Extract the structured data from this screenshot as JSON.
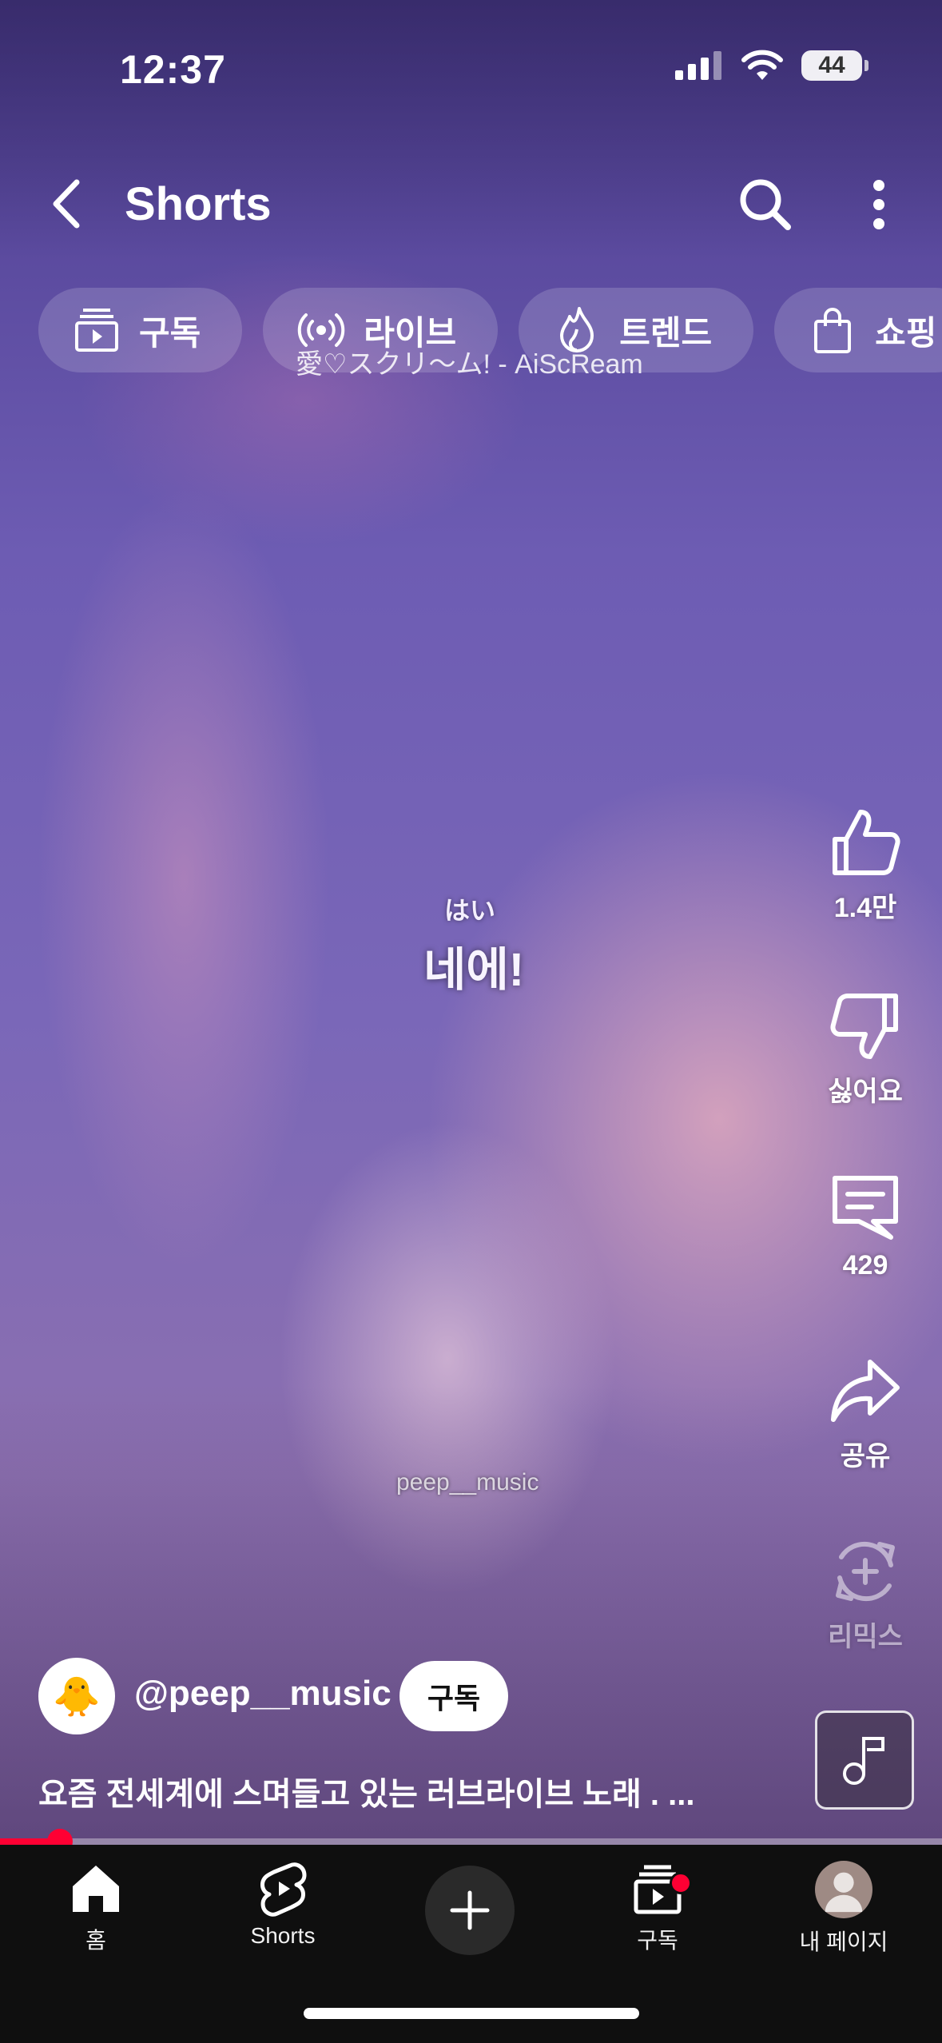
{
  "status": {
    "time": "12:37",
    "battery": "44"
  },
  "header": {
    "title": "Shorts"
  },
  "chips": [
    {
      "label": "구독",
      "icon": "subscriptions-icon"
    },
    {
      "label": "라이브",
      "icon": "live-icon"
    },
    {
      "label": "트렌드",
      "icon": "trending-flame-icon"
    },
    {
      "label": "쇼핑",
      "icon": "shopping-bag-icon"
    }
  ],
  "video": {
    "song_credit": "愛♡スクリ〜ム! - AiScReam",
    "caption_small": "はい",
    "caption_big": "네에!",
    "watermark": "peep__music"
  },
  "actions": {
    "like_count": "1.4만",
    "dislike_label": "싫어요",
    "comment_count": "429",
    "share_label": "공유",
    "remix_label": "리믹스"
  },
  "channel": {
    "avatar_emoji": "🐥",
    "handle": "@peep__music",
    "subscribe_label": "구독",
    "description": "요즘 전세계에 스며들고 있는 러브라이브 노래 . ..."
  },
  "progress": {
    "fraction": 0.064
  },
  "nav": {
    "home": "홈",
    "shorts": "Shorts",
    "subscriptions": "구독",
    "me": "내 페이지"
  },
  "colors": {
    "accent": "#ff0033",
    "nav_bg": "#0f0f0f"
  }
}
